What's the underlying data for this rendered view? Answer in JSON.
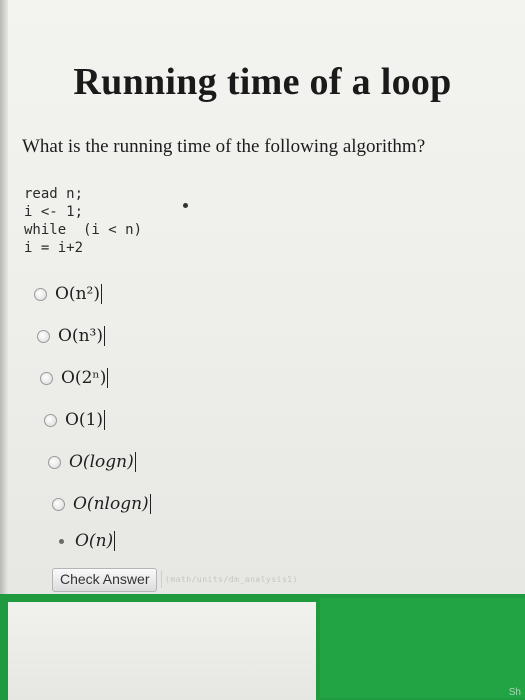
{
  "page": {
    "title": "Running time of a loop",
    "question": "What is the running time of the following algorithm?",
    "code_lines": [
      "read n;",
      "i <- 1;",
      "while  (i < n)",
      "i = i+2"
    ]
  },
  "options": [
    {
      "label": "O(n²)",
      "selected": false
    },
    {
      "label": "O(n³)",
      "selected": false
    },
    {
      "label": "O(2ⁿ)",
      "selected": false
    },
    {
      "label": "O(1)",
      "selected": false
    },
    {
      "label": "O(logn)",
      "selected": false
    },
    {
      "label": "O(nlogn)",
      "selected": false
    },
    {
      "label": "O(n)",
      "selected": true
    }
  ],
  "actions": {
    "check_answer_label": "Check Answer",
    "path_hint": "(math/units/dm_analysis1)"
  },
  "footer": {
    "corner_text": "Sh"
  },
  "colors": {
    "accent_green": "#1f9a3e",
    "page_bg": "#eeeeea"
  }
}
